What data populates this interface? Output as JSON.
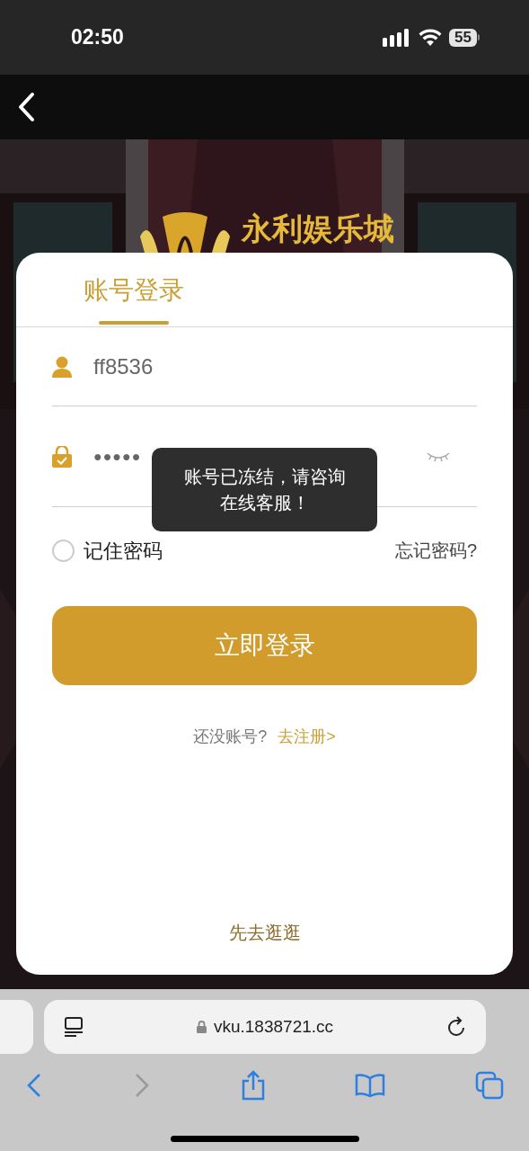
{
  "status_bar": {
    "time": "02:50",
    "battery": "55"
  },
  "banner": {
    "logo_text": "永利娱乐城"
  },
  "login": {
    "tabs": [
      {
        "label": "账号登录",
        "selected": true
      }
    ],
    "username": {
      "value": "ff8536"
    },
    "password": {
      "value": "●●●●●",
      "visible": false
    },
    "remember": {
      "label": "记住密码",
      "checked": false
    },
    "forgot": "忘记密码?",
    "submit": "立即登录",
    "register_prompt": "还没账号?",
    "register_link": "去注册>",
    "browse": "先去逛逛"
  },
  "toast": {
    "message": "账号已冻结，请咨询在线客服！"
  },
  "browser": {
    "url": "vku.1838721.cc"
  }
}
